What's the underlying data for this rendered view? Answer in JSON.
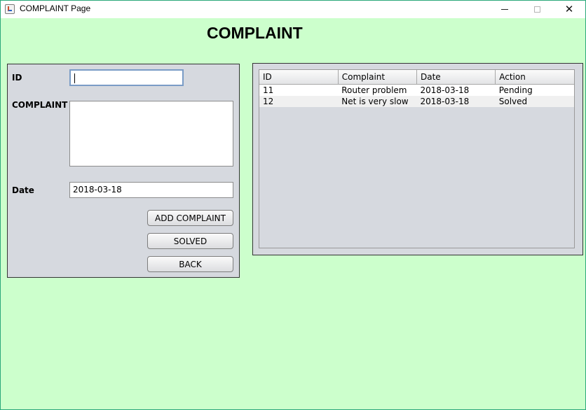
{
  "window": {
    "title": "COMPLAINT Page",
    "minimize": "—",
    "maximize": "□",
    "close": "✕"
  },
  "heading": "COMPLAINT",
  "form": {
    "id_label": "ID",
    "id_value": "",
    "complaint_label": "COMPLAINT",
    "complaint_value": "",
    "date_label": "Date",
    "date_value": "2018-03-18",
    "buttons": {
      "add": "ADD COMPLAINT",
      "solved": "SOLVED",
      "back": "BACK"
    }
  },
  "table": {
    "columns": [
      "ID",
      "Complaint",
      "Date",
      "Action"
    ],
    "rows": [
      [
        "11",
        "Router problem",
        "2018-03-18",
        "Pending"
      ],
      [
        "12",
        "Net is very slow",
        "2018-03-18",
        "Solved"
      ]
    ]
  },
  "colors": {
    "background": "#ccffcc",
    "panel": "#d6d9df"
  }
}
